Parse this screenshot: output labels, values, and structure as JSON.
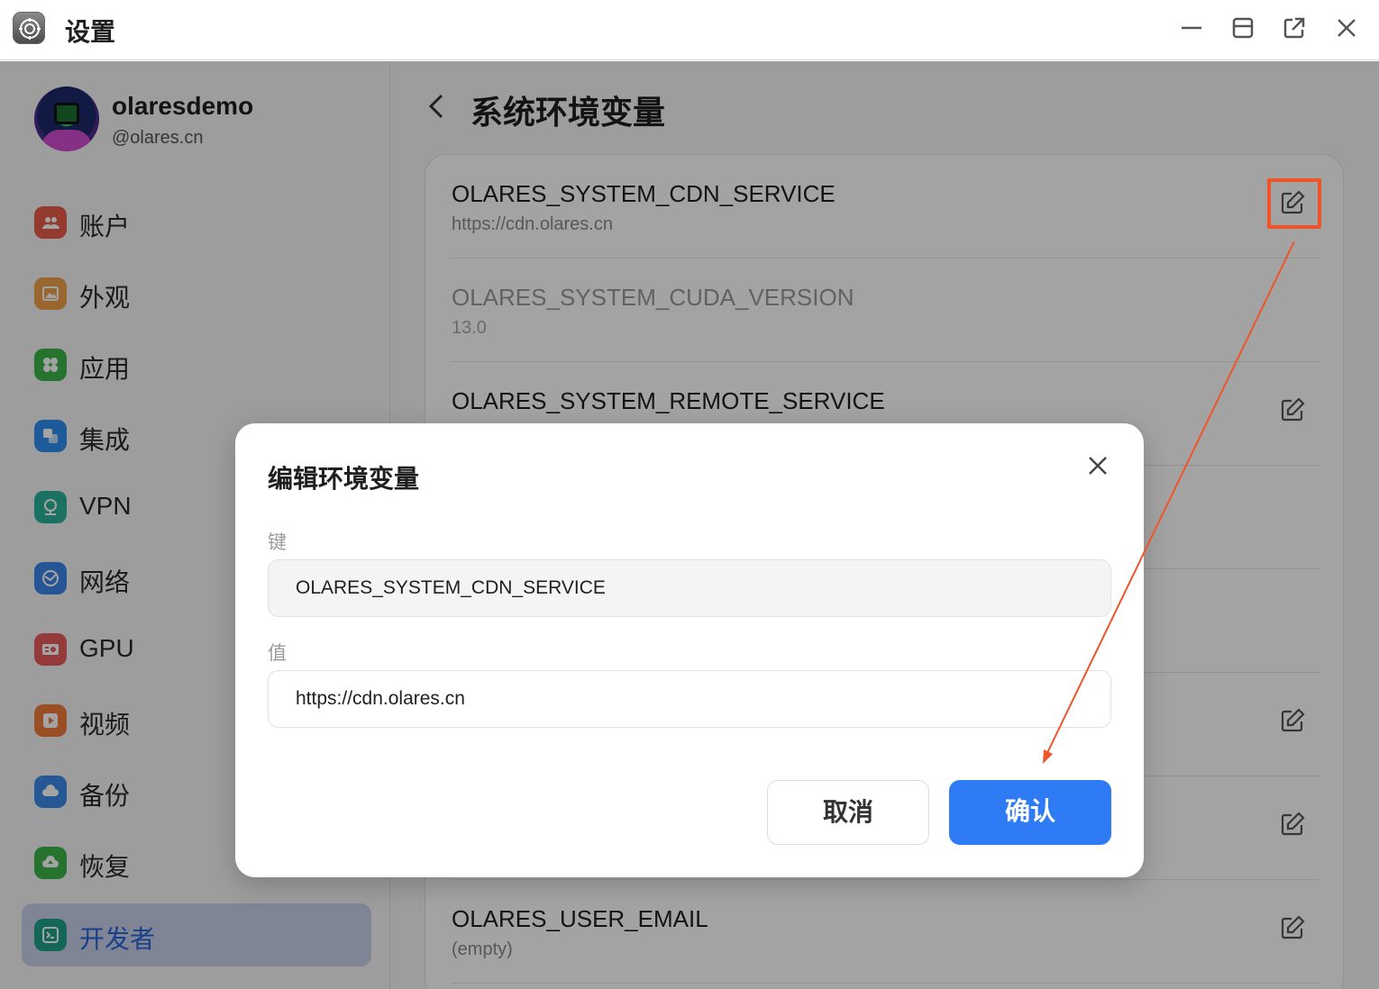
{
  "window": {
    "title": "设置",
    "controls": [
      "minimize-icon",
      "maximize-icon",
      "open-external-icon",
      "close-icon"
    ]
  },
  "user": {
    "name": "olaresdemo",
    "handle": "@olares.cn"
  },
  "sidebar": {
    "items": [
      {
        "label": "账户",
        "icon": "account-icon",
        "color": "#e85c4a",
        "active": false
      },
      {
        "label": "外观",
        "icon": "appearance-icon",
        "color": "#f0a04a",
        "active": false
      },
      {
        "label": "应用",
        "icon": "apps-icon",
        "color": "#3bb54a",
        "active": false
      },
      {
        "label": "集成",
        "icon": "integration-icon",
        "color": "#2d8ef0",
        "active": false
      },
      {
        "label": "VPN",
        "icon": "vpn-icon",
        "color": "#2bb39a",
        "active": false
      },
      {
        "label": "网络",
        "icon": "network-icon",
        "color": "#3a86e8",
        "active": false
      },
      {
        "label": "GPU",
        "icon": "gpu-icon",
        "color": "#e85c5c",
        "active": false
      },
      {
        "label": "视频",
        "icon": "video-icon",
        "color": "#f07a3a",
        "active": false
      },
      {
        "label": "备份",
        "icon": "backup-icon",
        "color": "#3a8ae8",
        "active": false
      },
      {
        "label": "恢复",
        "icon": "restore-icon",
        "color": "#3bb54a",
        "active": false
      },
      {
        "label": "开发者",
        "icon": "developer-icon",
        "color": "#1fa08a",
        "active": true
      }
    ]
  },
  "main": {
    "page_title": "系统环境变量",
    "env_vars": [
      {
        "key": "OLARES_SYSTEM_CDN_SERVICE",
        "value": "https://cdn.olares.cn",
        "editable": true
      },
      {
        "key": "OLARES_SYSTEM_CUDA_VERSION",
        "value": "13.0",
        "editable": false
      },
      {
        "key": "OLARES_SYSTEM_REMOTE_SERVICE",
        "value": "",
        "editable": true
      },
      {
        "key": "",
        "value": "",
        "editable": false
      },
      {
        "key": "",
        "value": "",
        "editable": false
      },
      {
        "key": "",
        "value": "",
        "editable": true
      },
      {
        "key": "",
        "value": "",
        "editable": true
      },
      {
        "key": "OLARES_USER_EMAIL",
        "value": "(empty)",
        "editable": true
      }
    ]
  },
  "dialog": {
    "title": "编辑环境变量",
    "key_label": "键",
    "key_value": "OLARES_SYSTEM_CDN_SERVICE",
    "value_label": "值",
    "value_value": "https://cdn.olares.cn",
    "cancel_label": "取消",
    "confirm_label": "确认"
  },
  "colors": {
    "accent": "#2f7bf6",
    "annotation": "#f0542a",
    "active_nav_bg": "#c7d0e8"
  }
}
